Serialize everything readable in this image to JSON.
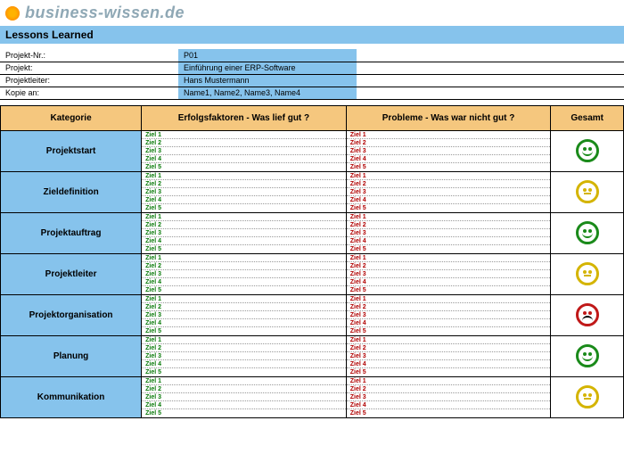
{
  "site": "business-wissen.de",
  "title": "Lessons Learned",
  "meta": [
    {
      "label": "Projekt-Nr.:",
      "value": "P01"
    },
    {
      "label": "Projekt:",
      "value": "Einführung einer ERP-Software"
    },
    {
      "label": "Projektleiter:",
      "value": "Hans Mustermann"
    },
    {
      "label": "Kopie an:",
      "value": "Name1, Name2, Name3, Name4"
    }
  ],
  "columns": {
    "kategorie": "Kategorie",
    "erfolg": "Erfolgsfaktoren - Was lief gut ?",
    "probleme": "Probleme - Was war nicht gut ?",
    "gesamt": "Gesamt"
  },
  "ziele": [
    "Ziel 1",
    "Ziel 2",
    "Ziel 3",
    "Ziel 4",
    "Ziel 5"
  ],
  "rows": [
    {
      "kategorie": "Projektstart",
      "mood": "happy",
      "color": "green"
    },
    {
      "kategorie": "Zieldefinition",
      "mood": "neutral",
      "color": "yellow"
    },
    {
      "kategorie": "Projektauftrag",
      "mood": "happy",
      "color": "green"
    },
    {
      "kategorie": "Projektleiter",
      "mood": "neutral",
      "color": "yellow"
    },
    {
      "kategorie": "Projektorganisation",
      "mood": "sad",
      "color": "red"
    },
    {
      "kategorie": "Planung",
      "mood": "happy",
      "color": "green"
    },
    {
      "kategorie": "Kommunikation",
      "mood": "neutral",
      "color": "yellow"
    }
  ]
}
